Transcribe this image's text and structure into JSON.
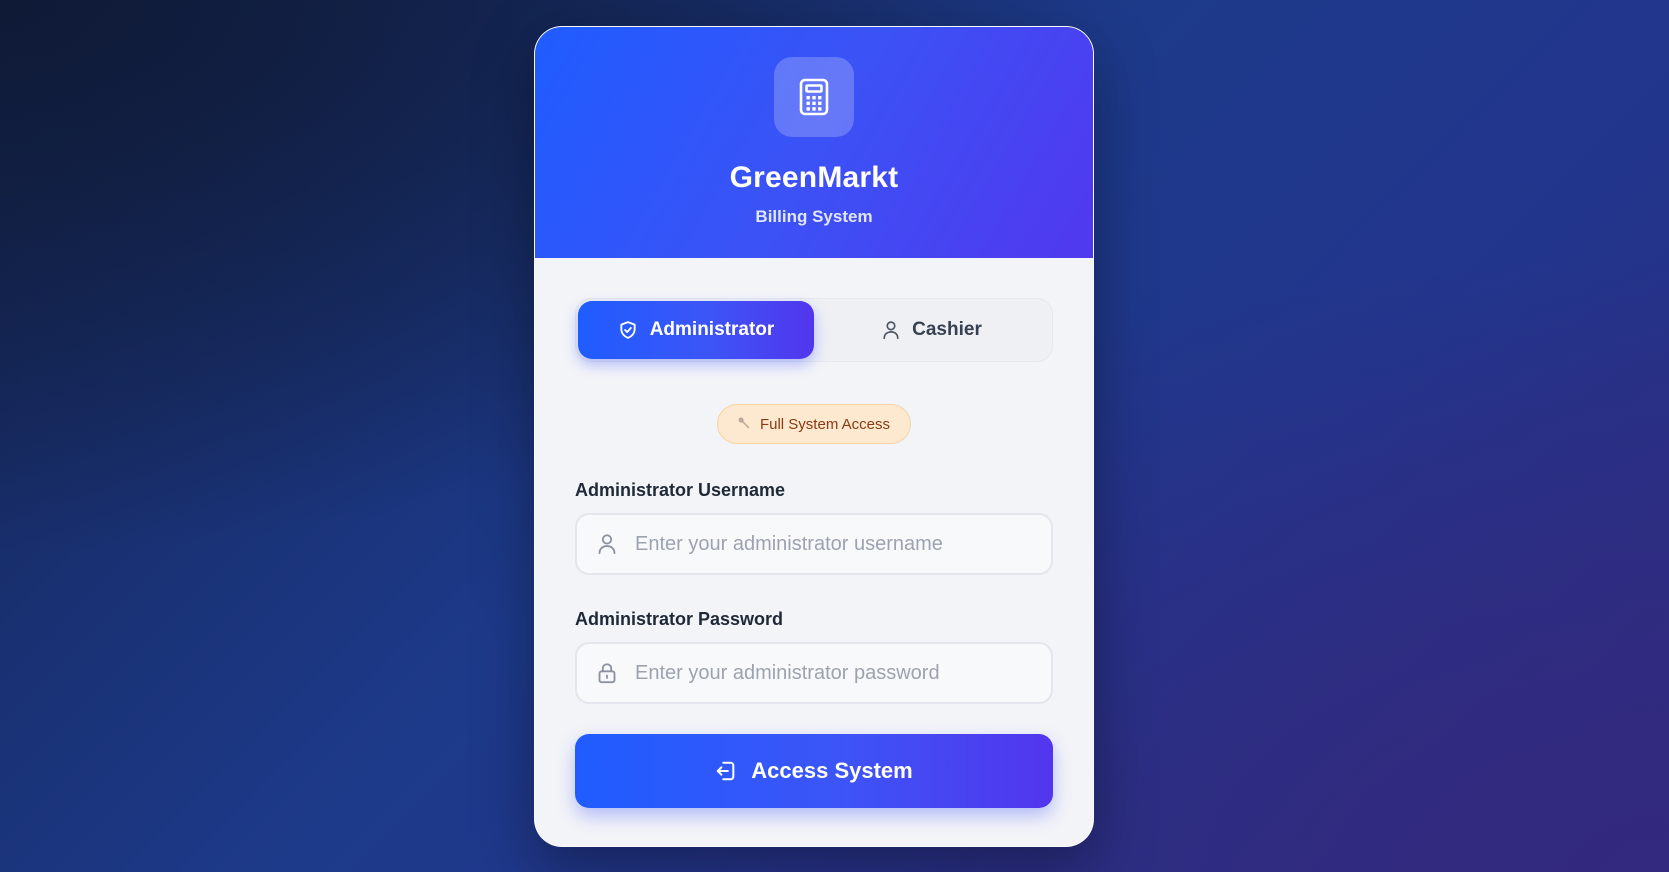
{
  "brand": {
    "title": "GreenMarkt",
    "subtitle": "Billing System",
    "logo_icon": "calculator-icon"
  },
  "role_toggle": {
    "selected": "Administrator",
    "tabs": [
      {
        "label": "Administrator",
        "icon": "shield-check-icon",
        "active": true
      },
      {
        "label": "Cashier",
        "icon": "user-icon",
        "active": false
      }
    ]
  },
  "access_badge": {
    "icon": "wrench-icon",
    "text": "Full System Access"
  },
  "form": {
    "username": {
      "label": "Administrator Username",
      "placeholder": "Enter your administrator username",
      "value": "",
      "icon": "user-icon"
    },
    "password": {
      "label": "Administrator Password",
      "placeholder": "Enter your administrator password",
      "value": "",
      "icon": "lock-icon"
    },
    "submit": {
      "label": "Access System",
      "icon": "login-icon"
    }
  },
  "colors": {
    "accent_start": "#1f5cff",
    "accent_end": "#5236ee",
    "badge_bg": "#fde9cf",
    "badge_text": "#8a3a12"
  }
}
